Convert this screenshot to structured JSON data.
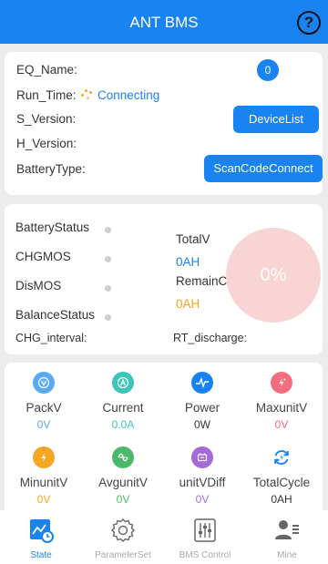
{
  "header": {
    "title": "ANT BMS",
    "help_icon": "question-circle-icon"
  },
  "info": {
    "eq_name_label": "EQ_Name:",
    "device_count": "0",
    "run_time_label": "Run_Time:",
    "run_time_value": "Connecting",
    "s_version_label": "S_Version:",
    "h_version_label": "H_Version:",
    "battery_type_label": "BatteryType:",
    "device_list_button": "DeviceList",
    "scan_button": "ScanCodeConnect"
  },
  "status": {
    "battery_status_label": "BatteryStatus",
    "chgmos_label": "CHGMOS",
    "dismos_label": "DisMOS",
    "balance_status_label": "BalanceStatus",
    "total_v_label": "TotalV",
    "total_v_value": "0AH",
    "remain_label": "RemainC",
    "remain_value": "0AH",
    "soc_value": "0%",
    "chg_interval_label": "CHG_interval:",
    "rt_discharge_label": "RT_discharge:"
  },
  "metrics": [
    {
      "name": "PackV",
      "value": "0V",
      "icon": "pack-voltage-icon",
      "color": "#5aa9f5",
      "value_color": "#5aa9f5"
    },
    {
      "name": "Current",
      "value": "0.0A",
      "icon": "current-icon",
      "color": "#3cc6b9",
      "value_color": "#3cc6b9"
    },
    {
      "name": "Power",
      "value": "0W",
      "icon": "power-pulse-icon",
      "color": "#1a83f2",
      "value_color": "#333333"
    },
    {
      "name": "MaxunitV",
      "value": "0V",
      "icon": "max-unit-voltage-icon",
      "color": "#f26d7d",
      "value_color": "#f26d7d"
    },
    {
      "name": "MinunitV",
      "value": "0V",
      "icon": "min-unit-voltage-icon",
      "color": "#f5a623",
      "value_color": "#f5a623"
    },
    {
      "name": "AvgunitV",
      "value": "0V",
      "icon": "avg-unit-voltage-icon",
      "color": "#4cb96a",
      "value_color": "#4cb96a"
    },
    {
      "name": "unitVDiff",
      "value": "0V",
      "icon": "unit-voltage-diff-icon",
      "color": "#a66ad8",
      "value_color": "#a66ad8"
    },
    {
      "name": "TotalCycle",
      "value": "0AH",
      "icon": "total-cycle-icon",
      "color": "#1a83f2",
      "value_color": "#333333"
    }
  ],
  "tabs": [
    {
      "label": "State",
      "icon": "state-chart-icon",
      "active": true
    },
    {
      "label": "ParameterSet",
      "icon": "gear-icon",
      "active": false
    },
    {
      "label": "BMS Control",
      "icon": "sliders-icon",
      "active": false
    },
    {
      "label": "Mine",
      "icon": "user-profile-icon",
      "active": false
    }
  ]
}
